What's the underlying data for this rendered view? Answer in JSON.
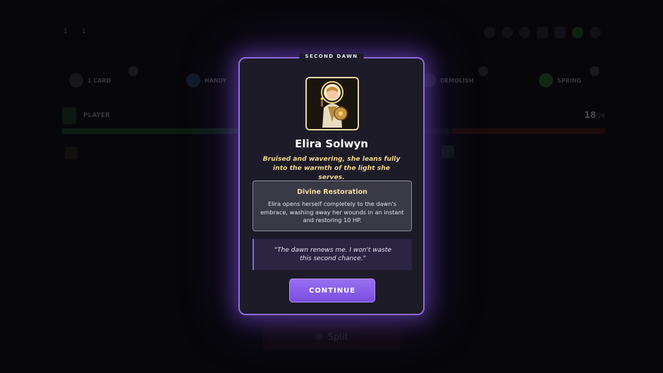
{
  "background": {
    "stats": [
      {
        "label": "",
        "value": "1"
      },
      {
        "label": "",
        "value": "1"
      }
    ],
    "round_label": "",
    "chips": [
      {
        "label": "1 CARD",
        "icon": "card-icon"
      },
      {
        "label": "HANDY",
        "icon": "hand-icon"
      },
      {
        "label": "DEMOLISH",
        "icon": "hammer-icon"
      },
      {
        "label": "SPRING",
        "icon": "leaf-icon"
      }
    ],
    "player": {
      "name": "PLAYER",
      "hp": "18",
      "hp_max": "/26"
    },
    "split_label": "Split"
  },
  "modal": {
    "tag": "SECOND DAWN",
    "hero_name": "Elira Solwyn",
    "hero_description": "Bruised and wavering, she leans fully into the warmth of the light she serves.",
    "ability": {
      "title": "Divine Restoration",
      "text": "Elira opens herself completely to the dawn's embrace, washing away her wounds in an instant and restoring 10 HP."
    },
    "quote": "\"The dawn renews me. I won't waste this second chance.\"",
    "continue_label": "CONTINUE",
    "colors": {
      "accent": "#8f6ad9",
      "button": "#8a5cf0",
      "gold_text": "#f2d58a"
    }
  }
}
